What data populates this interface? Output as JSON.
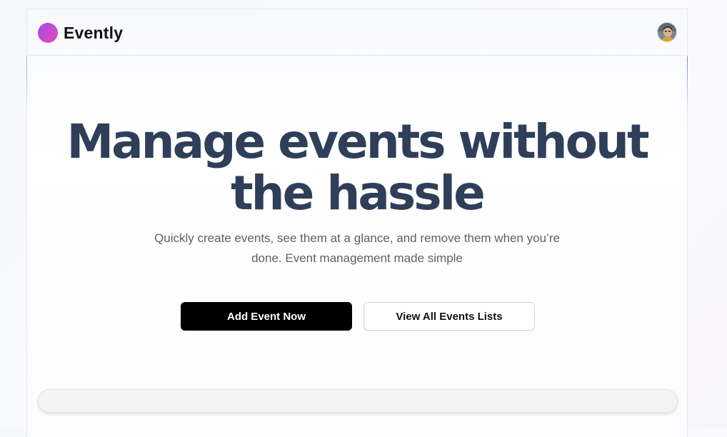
{
  "header": {
    "brand": "Evently",
    "avatar_alt": "user avatar"
  },
  "hero": {
    "title": "Manage events without the hassle",
    "subtitle": "Quickly create events, see them at a glance, and remove them when you’re done. Event management made simple"
  },
  "actions": {
    "primary_label": "Add Event Now",
    "secondary_label": "View All Events Lists"
  },
  "icons": {
    "logo": "brand-logo-icon",
    "avatar": "user-avatar-icon"
  },
  "colors": {
    "brand_gradient_start": "#a34be8",
    "brand_gradient_end": "#e24cb6",
    "title": "#2f3f59",
    "primary_button": "#000000"
  }
}
